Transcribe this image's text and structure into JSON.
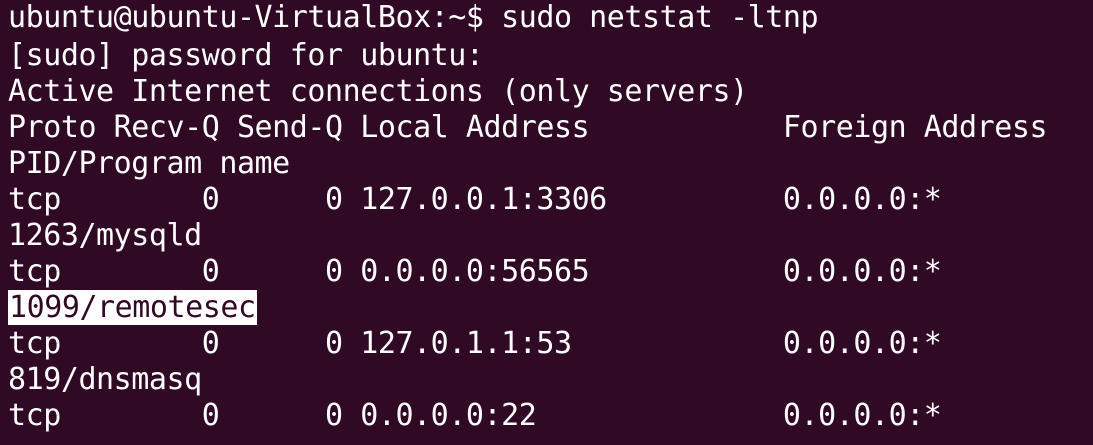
{
  "terminal": {
    "background": "#300a24",
    "foreground": "#ffffff",
    "highlight_background": "#ffffff",
    "lines": [
      "ubuntu@ubuntu-VirtualBox:~$ sudo netstat -ltnp",
      "[sudo] password for ubuntu:",
      "Active Internet connections (only servers)",
      "Proto Recv-Q Send-Q Local Address           Foreign Address",
      "PID/Program name",
      "tcp        0      0 127.0.0.1:3306          0.0.0.0:*",
      "1263/mysqld",
      "tcp        0      0 0.0.0.0:56565           0.0.0.0:*",
      "1099/remotesec",
      "tcp        0      0 127.0.1.1:53            0.0.0.0:*",
      "819/dnsmasq",
      "tcp        0      0 0.0.0.0:22              0.0.0.0:*"
    ]
  }
}
